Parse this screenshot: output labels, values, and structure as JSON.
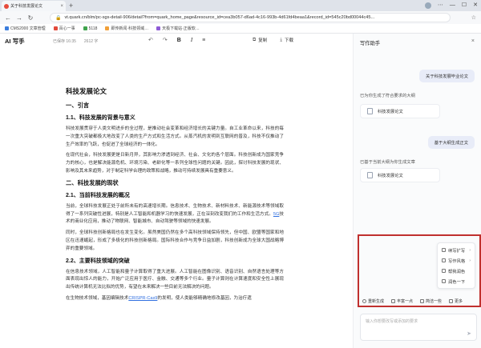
{
  "browser": {
    "tab_title": "关于科技发展论文",
    "tab_close": "×",
    "new_tab": "+",
    "url": "vt.quark.cn/blm/pc-sgs-detail-906/detail?from=quark_home_page&resource_id=cea3b057-d6ad-4c16-993b-4d61fd4beaa1&record_id=545c20bd00044c45...",
    "bookmarks": [
      "CMS2000 文章管理",
      "百心一事",
      "5118",
      "即传新闻·科技领域…",
      "天极下载站·正版软…"
    ],
    "bookmark_colors": [
      "#3b7ddd",
      "#e2493a",
      "#3fa34d",
      "#f1a03a",
      "#8e5bd6"
    ]
  },
  "app": {
    "logo": "AI 写手",
    "saved": "已保存 16:35",
    "words": "2612 字",
    "undo_icon": "↶",
    "redo_icon": "↷",
    "bold": "B",
    "italic": "I",
    "list_icon": "≡",
    "copy_label": "复制",
    "download_label": "下载"
  },
  "doc": {
    "title": "科技发展论文",
    "h_intro": "一、引言",
    "h_1_1": "1.1、科技发展的背景与意义",
    "p1": "科技发展贯穿于人类文明进步的全过程，是推动社会变革和经济增长的关键力量。自工业革命以来，科技的每一次重大突破都极大地改变了人类的生产方式和生活方式。从蒸汽机的发明到互联网的普及，科技不仅推动了生产效率的飞跃，也促进了全球经济的一体化。",
    "p2": "在现代社会，科技发展更是日新月异，其影响力渗透到经济、社会、文化的各个层面。科技创新成为国家竞争力的核心，也是解决能源危机、环境污染、老龄化等一系列全球性问题的关键。因此，探讨科技发展的现状、影响及其未来趋势，对于制定科学合理的政策和战略，推动可持续发展具有重要意义。",
    "h_2": "二、科技发展的现状",
    "h_2_1": "2.1、当前科技发展的概况",
    "p3": "当前，全球科技发展正处于前所未有的高速增长期。信息技术、生物技术、新材料技术、新能源技术等领域取得了一系列突破性进展，特别是人工智能和机器学习的快速发展，正在深刻改变我们的工作和生活方式。",
    "p3_link": "5G",
    "p3_tail": "技术的商业化应用，推动了物联网、智能城市、自动驾驶等领域的快速发展。",
    "p4": "同时，全球科技创新格局也在发生变化。虽然美国仍然在多个高科技领域保持领先，但中国、欧盟等国家和地区在迅速崛起，形成了多极化的科技创新格局。国际科技合作与竞争日益加剧，科技创新成为全球大国战略博弈的重要领域。",
    "h_2_2": "2.2、主要科技领域的突破",
    "p5": "在信息技术领域，人工智能和量子计算取得了重大进展。人工智能在图像识别、语音识别、自然语言处理等方面表现出惊人的能力，开始广泛应用于医疗、金融、交通等多个行业。量子计算则在计算速度和安全性上展现出传统计算机无法比拟的优势，有望在未来解决一些目前无法解决的问题。",
    "p6_head": "在生物技术领域，基因编辑技术",
    "p6_link": "CRISPR-Cas9",
    "p6_tail": "的发明，使人类能够精确地修改基因，为治疗遗"
  },
  "panel": {
    "title": "写作助手",
    "close_icon": "×",
    "bubble1": "关于科技发展毕业论文",
    "sys1": "已为你生成了符合要求的大纲",
    "card1": "科技发展论文",
    "bubble2": "基于大纲生成正文",
    "sys2": "已基于当前大纲为你生成文章",
    "card2": "科技发展论文",
    "menu": [
      "续写扩写",
      "写作风格",
      "帮我润色",
      "润色一下"
    ],
    "actions": [
      "重新生成",
      "丰富一点",
      "简洁一些",
      "更多"
    ],
    "input_placeholder": "输入你想要改写或添加的要求",
    "send_icon": "➤"
  }
}
